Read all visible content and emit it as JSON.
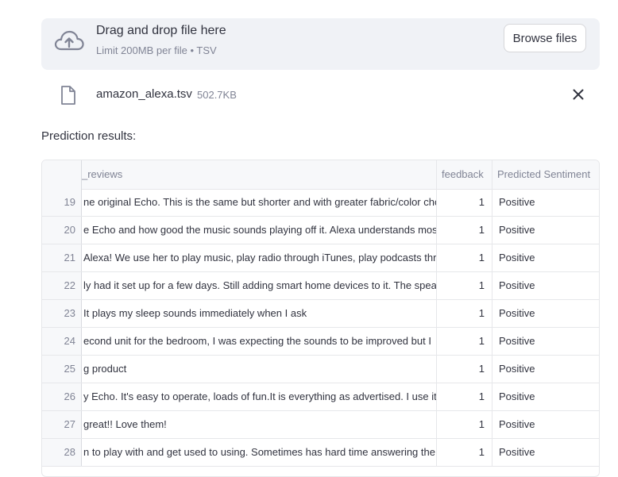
{
  "uploader": {
    "drop_title": "Drag and drop file here",
    "limit_text": "Limit 200MB per file • TSV",
    "browse_label": "Browse files",
    "icon": "cloud-upload-icon"
  },
  "file": {
    "name": "amazon_alexa.tsv",
    "size": "502.7KB",
    "icon": "file-icon",
    "remove_icon": "close-icon"
  },
  "results_label": "Prediction results:",
  "table": {
    "columns": {
      "index": "",
      "reviews": "_reviews",
      "feedback": "feedback",
      "sentiment": "Predicted Sentiment"
    },
    "rows": [
      {
        "index": "19",
        "review": "ne original Echo. This is the same but shorter and with greater fabric/color cho",
        "feedback": "1",
        "sentiment": "Positive"
      },
      {
        "index": "20",
        "review": "e Echo and how good the music sounds playing off it. Alexa understands most",
        "feedback": "1",
        "sentiment": "Positive"
      },
      {
        "index": "21",
        "review": "Alexa! We use her to play music, play radio through iTunes, play podcasts thr",
        "feedback": "1",
        "sentiment": "Positive"
      },
      {
        "index": "22",
        "review": "ly had it set up for a few days. Still adding smart home devices to it. The spea",
        "feedback": "1",
        "sentiment": "Positive"
      },
      {
        "index": "23",
        "review": "It plays my sleep sounds immediately when I ask",
        "feedback": "1",
        "sentiment": "Positive"
      },
      {
        "index": "24",
        "review": "econd unit for the bedroom, I was expecting the sounds to be improved but I",
        "feedback": "1",
        "sentiment": "Positive"
      },
      {
        "index": "25",
        "review": "g product",
        "feedback": "1",
        "sentiment": "Positive"
      },
      {
        "index": "26",
        "review": "y Echo. It's easy to operate, loads of fun.It is everything as advertised. I use it",
        "feedback": "1",
        "sentiment": "Positive"
      },
      {
        "index": "27",
        "review": "great!! Love them!",
        "feedback": "1",
        "sentiment": "Positive"
      },
      {
        "index": "28",
        "review": "n to play with and get used to using.  Sometimes has hard time answering the",
        "feedback": "1",
        "sentiment": "Positive"
      }
    ]
  },
  "colors": {
    "uploader_bg": "#f0f2f6",
    "text": "#31333f",
    "muted": "#808495",
    "border": "#e6e7ea"
  }
}
